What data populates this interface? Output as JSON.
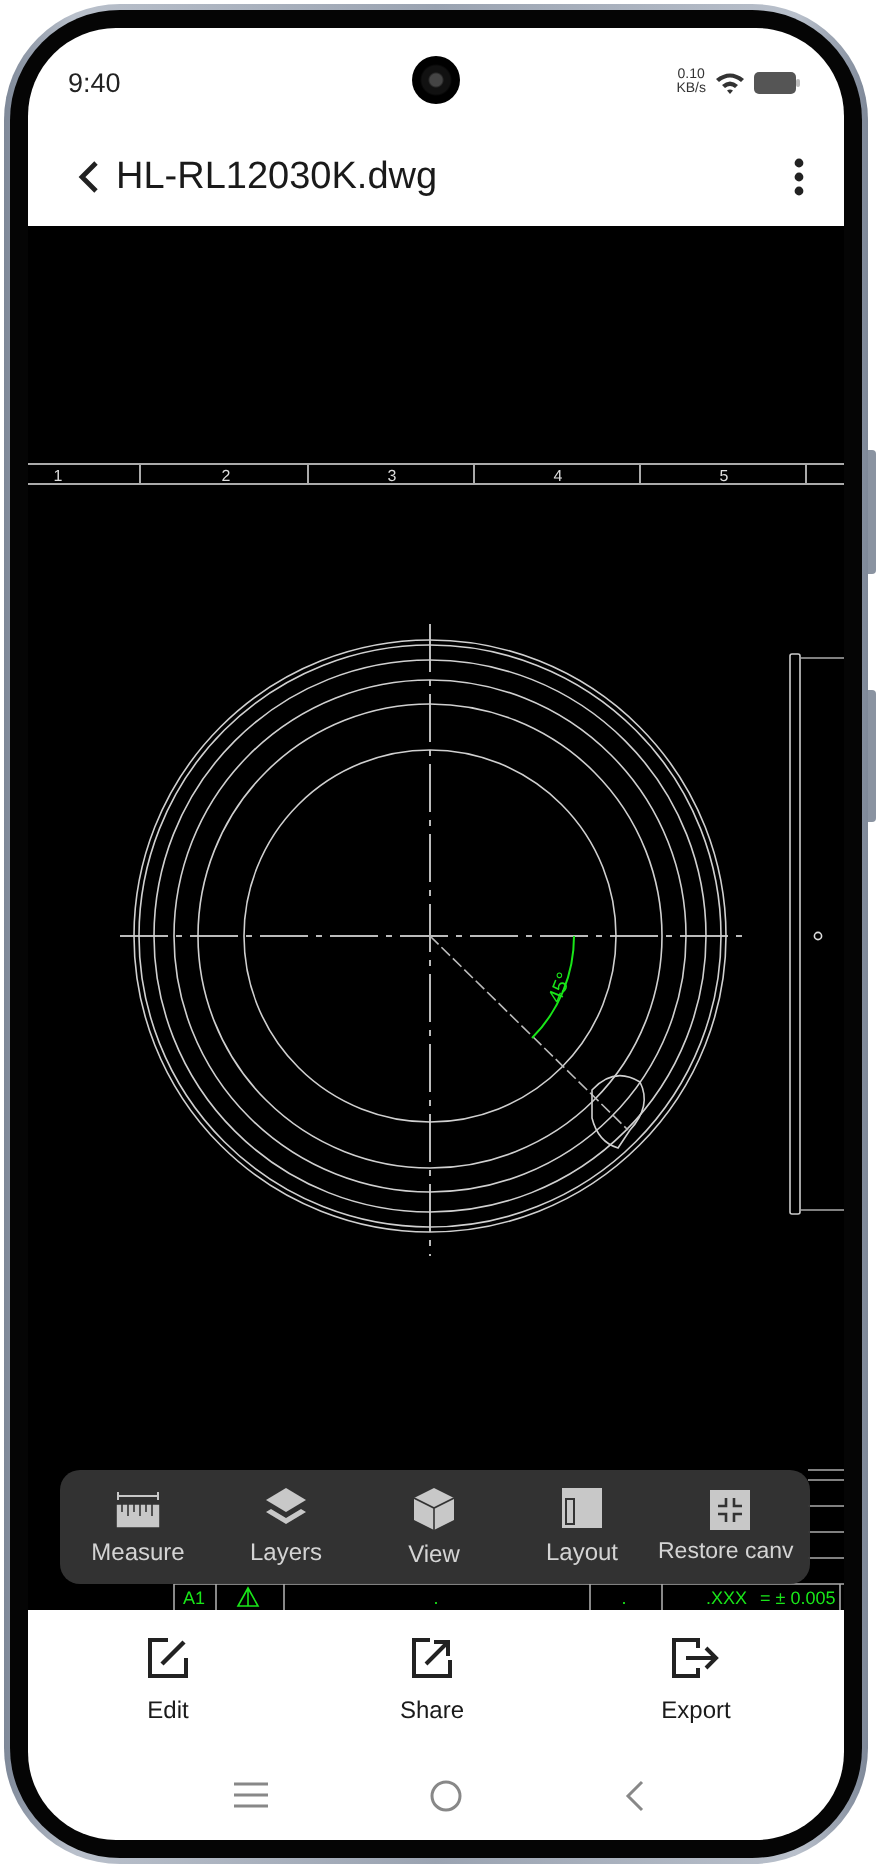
{
  "status_bar": {
    "time": "9:40",
    "net_speed": "0.10",
    "net_unit": "KB/s"
  },
  "app_bar": {
    "title": "HL-RL12030K.dwg"
  },
  "drawing": {
    "column_labels": [
      "1",
      "2",
      "3",
      "4",
      "5"
    ],
    "angle_label": "45°",
    "title_block": [
      {
        "kind": "text",
        "text": "A1"
      },
      {
        "kind": "text",
        "text": "."
      },
      {
        "kind": "text",
        "text": "."
      },
      {
        "kind": "text",
        "text": ".XXX"
      },
      {
        "kind": "text",
        "text": "= ± 0.005"
      }
    ]
  },
  "toolbar": [
    {
      "kind": "measure",
      "label": "Measure"
    },
    {
      "kind": "layers",
      "label": "Layers"
    },
    {
      "kind": "view",
      "label": "View"
    },
    {
      "kind": "layout",
      "label": "Layout"
    },
    {
      "kind": "restore",
      "label": "Restore canv"
    }
  ],
  "actions": [
    {
      "kind": "edit",
      "label": "Edit"
    },
    {
      "kind": "share",
      "label": "Share"
    },
    {
      "kind": "export",
      "label": "Export"
    }
  ]
}
